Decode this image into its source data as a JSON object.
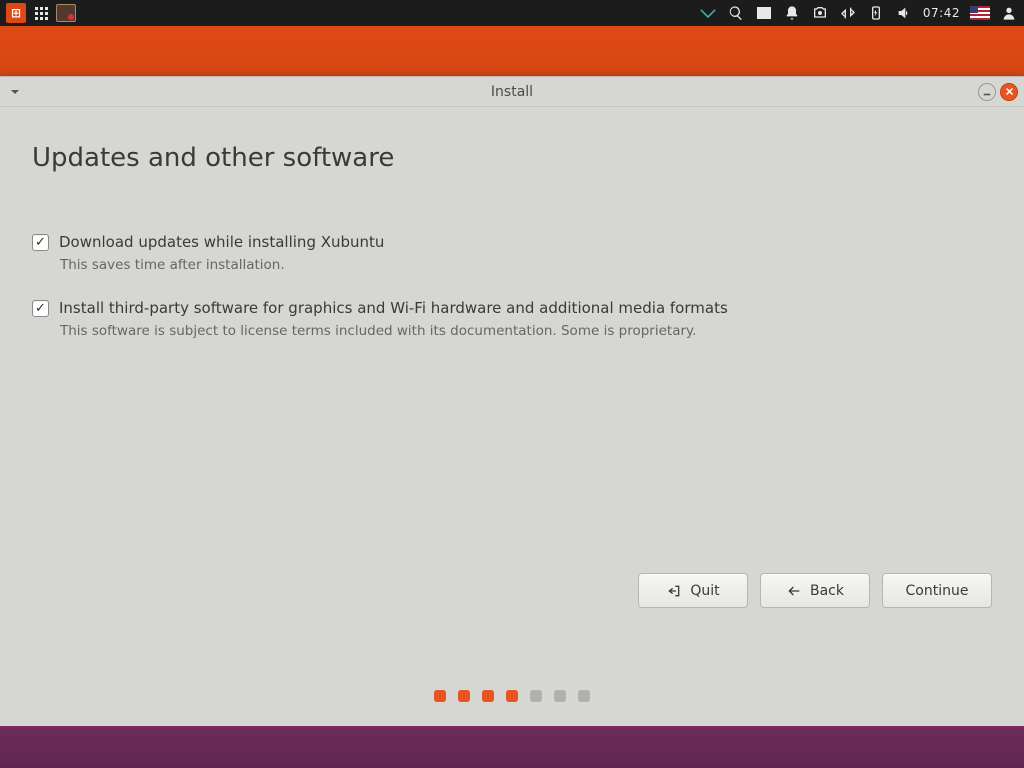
{
  "panel": {
    "time": "07:42"
  },
  "window": {
    "title": "Install"
  },
  "page": {
    "heading": "Updates and other software"
  },
  "options": {
    "download_updates": {
      "label": "Download updates while installing Xubuntu",
      "desc": "This saves time after installation.",
      "checked": true
    },
    "third_party": {
      "label": "Install third-party software for graphics and Wi-Fi hardware and additional media formats",
      "desc": "This software is subject to license terms included with its documentation. Some is proprietary.",
      "checked": true
    }
  },
  "buttons": {
    "quit": "Quit",
    "back": "Back",
    "continue": "Continue"
  },
  "progress": {
    "total": 7,
    "current": 4
  }
}
